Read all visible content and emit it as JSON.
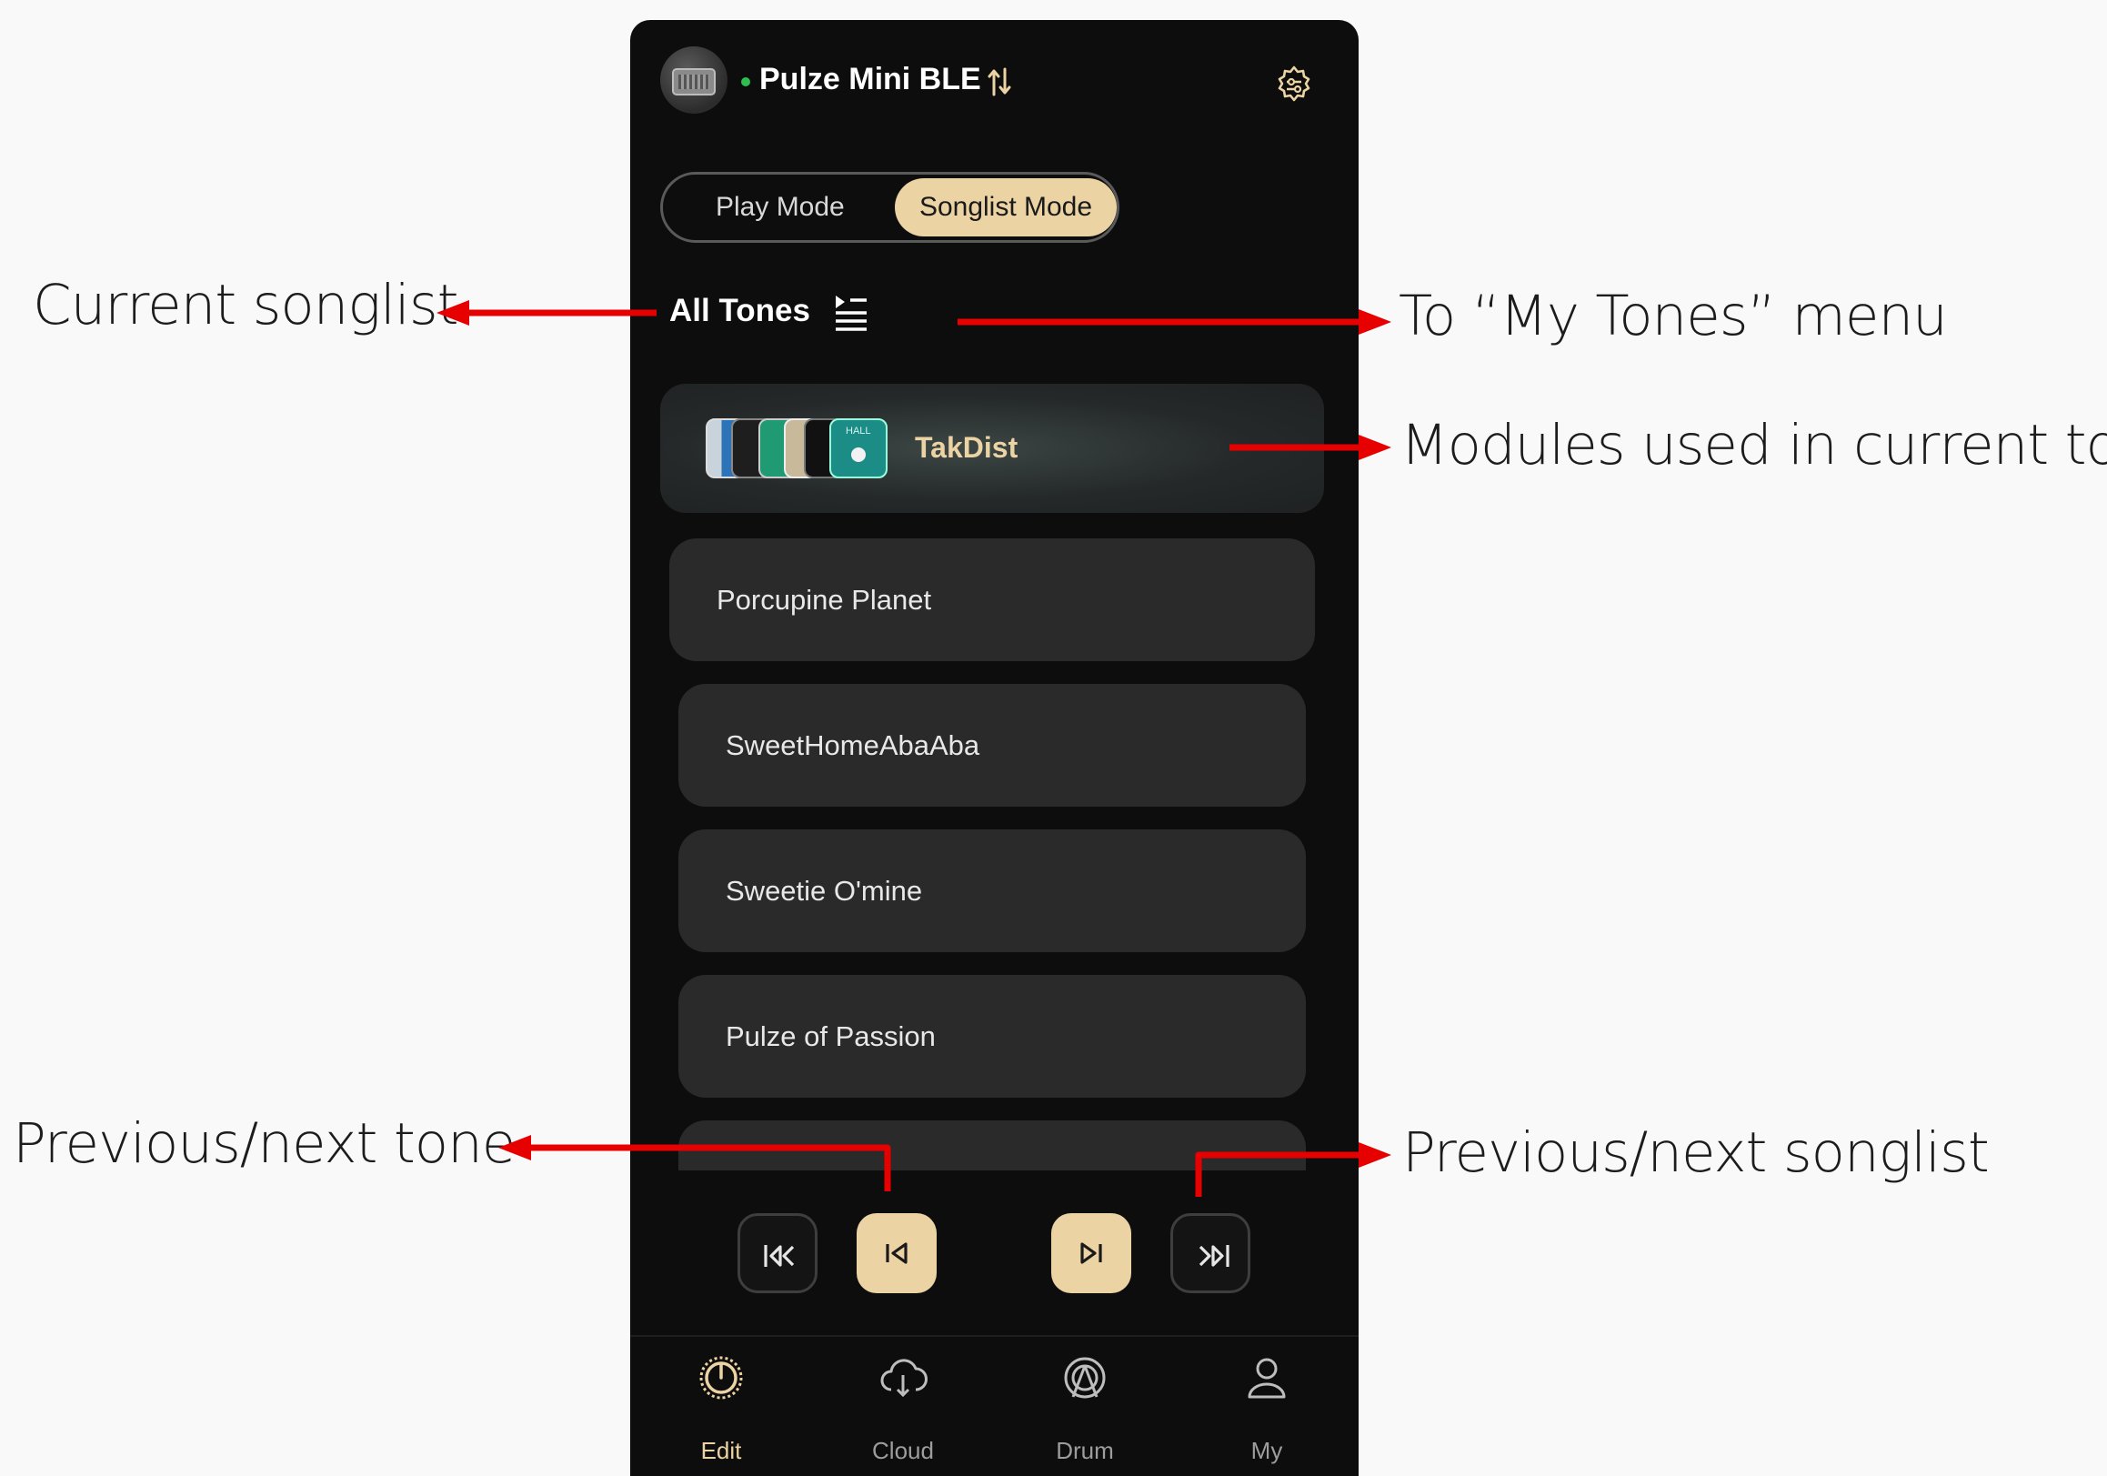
{
  "header": {
    "device_name": "Pulze Mini BLE",
    "status_color": "#2fbf50"
  },
  "mode_toggle": {
    "options": [
      "Play Mode",
      "Songlist Mode"
    ],
    "selected": "Songlist Mode"
  },
  "songlist": {
    "title": "All Tones",
    "current_tone": {
      "name": "TakDist",
      "modules": [
        "blue-module",
        "dark-module",
        "green-module",
        "beige-module",
        "hall-module"
      ],
      "module_labels": [
        "HALL"
      ]
    },
    "tones": [
      "Porcupine Planet",
      "SweetHomeAbaAba",
      "Sweetie O'mine",
      "Pulze of Passion"
    ]
  },
  "transport": {
    "buttons": [
      "previous-songlist",
      "previous-tone",
      "next-tone",
      "next-songlist"
    ]
  },
  "tabbar": {
    "tabs": [
      "Edit",
      "Cloud",
      "Drum",
      "My"
    ],
    "active": "Edit"
  },
  "annotations": {
    "current_songlist": "Current songlist",
    "my_tones_menu": "To “My Tones” menu",
    "modules_used": "Modules used in current tone",
    "prev_next_tone": "Previous/next tone",
    "prev_next_songlist": "Previous/next songlist"
  },
  "colors": {
    "accent": "#ecd3a3",
    "background": "#0d0d0d",
    "card": "#2a2a2a",
    "arrow": "#e60000"
  }
}
